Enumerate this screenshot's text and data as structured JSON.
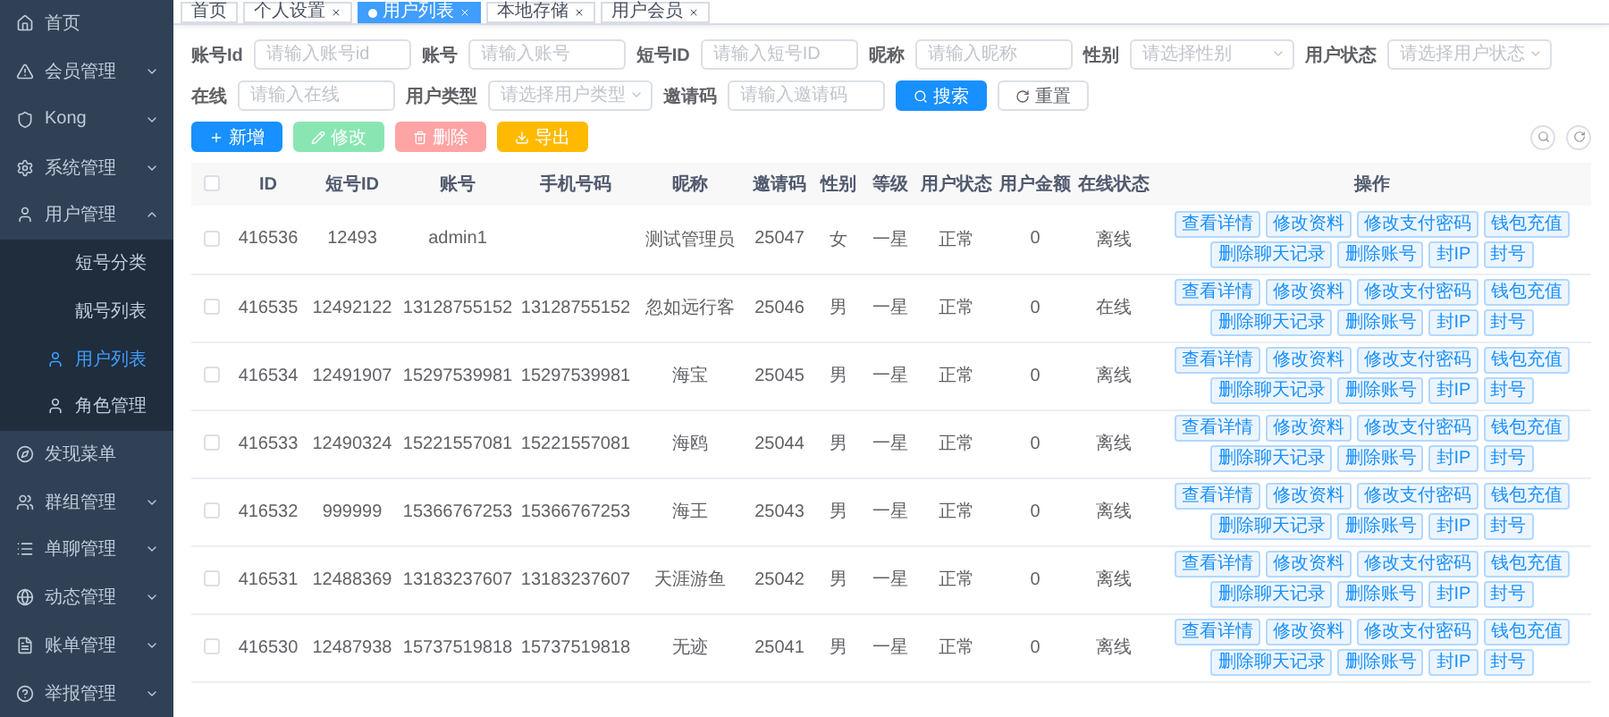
{
  "sidebar": {
    "items": [
      {
        "label": "首页",
        "kind": "link",
        "selected": false
      },
      {
        "label": "会员管理",
        "kind": "group",
        "expanded": false,
        "selected": false
      },
      {
        "label": "Kong",
        "kind": "group",
        "expanded": false,
        "selected": false
      },
      {
        "label": "系统管理",
        "kind": "group",
        "expanded": false,
        "selected": false
      },
      {
        "label": "用户管理",
        "kind": "group",
        "expanded": true,
        "selected": false,
        "children": [
          {
            "label": "短号分类",
            "selected": false,
            "icon": false
          },
          {
            "label": "靓号列表",
            "selected": false,
            "icon": false
          },
          {
            "label": "用户列表",
            "selected": true,
            "icon": true
          },
          {
            "label": "角色管理",
            "selected": false,
            "icon": true
          }
        ]
      },
      {
        "label": "发现菜单",
        "kind": "link",
        "selected": false
      },
      {
        "label": "群组管理",
        "kind": "group",
        "expanded": false,
        "selected": false
      },
      {
        "label": "单聊管理",
        "kind": "group",
        "expanded": false,
        "selected": false
      },
      {
        "label": "动态管理",
        "kind": "group",
        "expanded": false,
        "selected": false
      },
      {
        "label": "账单管理",
        "kind": "group",
        "expanded": false,
        "selected": false
      },
      {
        "label": "举报管理",
        "kind": "group",
        "expanded": false,
        "selected": false
      }
    ]
  },
  "tabs": [
    {
      "label": "首页",
      "selected": false,
      "closable": false
    },
    {
      "label": "个人设置",
      "selected": false,
      "closable": true
    },
    {
      "label": "用户列表",
      "selected": true,
      "closable": true
    },
    {
      "label": "本地存储",
      "selected": false,
      "closable": true
    },
    {
      "label": "用户会员",
      "selected": false,
      "closable": true
    }
  ],
  "filters": [
    [
      {
        "label": "账号Id",
        "placeholder": "请输入账号id",
        "kind": "input"
      },
      {
        "label": "账号",
        "placeholder": "请输入账号",
        "kind": "input"
      },
      {
        "label": "短号ID",
        "placeholder": "请输入短号ID",
        "kind": "input"
      },
      {
        "label": "昵称",
        "placeholder": "请输入昵称",
        "kind": "input"
      },
      {
        "label": "性别",
        "placeholder": "请选择性别",
        "kind": "select"
      },
      {
        "label": "用户状态",
        "placeholder": "请选择用户状态",
        "kind": "select"
      }
    ],
    [
      {
        "label": "在线",
        "placeholder": "请输入在线",
        "kind": "input"
      },
      {
        "label": "用户类型",
        "placeholder": "请选择用户类型",
        "kind": "select"
      },
      {
        "label": "邀请码",
        "placeholder": "请输入邀请码",
        "kind": "input"
      }
    ]
  ],
  "search_button": "搜索",
  "reset_button": "重置",
  "toolbar": [
    {
      "label": "新增",
      "kind": "add",
      "disabled": false
    },
    {
      "label": "修改",
      "kind": "edit",
      "disabled": true
    },
    {
      "label": "删除",
      "kind": "delete",
      "disabled": true
    },
    {
      "label": "导出",
      "kind": "export",
      "disabled": false
    }
  ],
  "table": {
    "all_checked": false,
    "columns": [
      "ID",
      "短号ID",
      "账号",
      "手机号码",
      "昵称",
      "邀请码",
      "性别",
      "等级",
      "用户状态",
      "用户金额",
      "在线状态",
      "操作"
    ],
    "rows": [
      {
        "checked": false,
        "actions": [
          [
            "查看详情",
            "修改资料",
            "修改支付密码",
            "钱包充值"
          ],
          [
            "删除聊天记录",
            "删除账号",
            "封IP",
            "封号"
          ]
        ],
        "cells": [
          "416536",
          "12493",
          "admin1",
          "",
          "测试管理员",
          "25047",
          "女",
          "一星",
          "正常",
          "0",
          "离线"
        ]
      },
      {
        "checked": false,
        "actions": [
          [
            "查看详情",
            "修改资料",
            "修改支付密码",
            "钱包充值"
          ],
          [
            "删除聊天记录",
            "删除账号",
            "封IP",
            "封号"
          ]
        ],
        "cells": [
          "416535",
          "12492122",
          "13128755152",
          "13128755152",
          "忽如远行客",
          "25046",
          "男",
          "一星",
          "正常",
          "0",
          "在线"
        ]
      },
      {
        "checked": false,
        "actions": [
          [
            "查看详情",
            "修改资料",
            "修改支付密码",
            "钱包充值"
          ],
          [
            "删除聊天记录",
            "删除账号",
            "封IP",
            "封号"
          ]
        ],
        "cells": [
          "416534",
          "12491907",
          "15297539981",
          "15297539981",
          "海宝",
          "25045",
          "男",
          "一星",
          "正常",
          "0",
          "离线"
        ]
      },
      {
        "checked": false,
        "actions": [
          [
            "查看详情",
            "修改资料",
            "修改支付密码",
            "钱包充值"
          ],
          [
            "删除聊天记录",
            "删除账号",
            "封IP",
            "封号"
          ]
        ],
        "cells": [
          "416533",
          "12490324",
          "15221557081",
          "15221557081",
          "海鸥",
          "25044",
          "男",
          "一星",
          "正常",
          "0",
          "离线"
        ]
      },
      {
        "checked": false,
        "actions": [
          [
            "查看详情",
            "修改资料",
            "修改支付密码",
            "钱包充值"
          ],
          [
            "删除聊天记录",
            "删除账号",
            "封IP",
            "封号"
          ]
        ],
        "cells": [
          "416532",
          "999999",
          "15366767253",
          "15366767253",
          "海王",
          "25043",
          "男",
          "一星",
          "正常",
          "0",
          "离线"
        ]
      },
      {
        "checked": false,
        "actions": [
          [
            "查看详情",
            "修改资料",
            "修改支付密码",
            "钱包充值"
          ],
          [
            "删除聊天记录",
            "删除账号",
            "封IP",
            "封号"
          ]
        ],
        "cells": [
          "416531",
          "12488369",
          "13183237607",
          "13183237607",
          "天涯游鱼",
          "25042",
          "男",
          "一星",
          "正常",
          "0",
          "离线"
        ]
      },
      {
        "checked": false,
        "actions": [
          [
            "查看详情",
            "修改资料",
            "修改支付密码",
            "钱包充值"
          ],
          [
            "删除聊天记录",
            "删除账号",
            "封IP",
            "封号"
          ]
        ],
        "cells": [
          "416530",
          "12487938",
          "15737519818",
          "15737519818",
          "无迹",
          "25041",
          "男",
          "一星",
          "正常",
          "0",
          "离线"
        ]
      }
    ]
  }
}
